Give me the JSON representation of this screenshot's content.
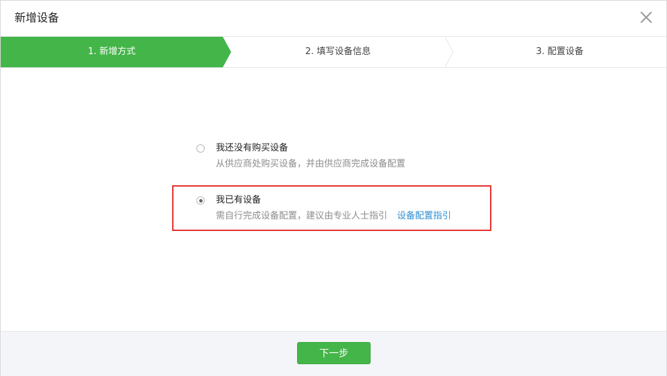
{
  "dialog": {
    "title": "新增设备",
    "close_icon": "close-icon"
  },
  "steps": [
    {
      "label": "1. 新增方式",
      "state": "active"
    },
    {
      "label": "2. 填写设备信息",
      "state": "inactive"
    },
    {
      "label": "3. 配置设备",
      "state": "inactive"
    }
  ],
  "options": [
    {
      "title": "我还没有购买设备",
      "description": "从供应商处购买设备，并由供应商完成设备配置",
      "selected": false
    },
    {
      "title": "我已有设备",
      "description": "需自行完成设备配置，建议由专业人士指引",
      "link": "设备配置指引",
      "selected": true
    }
  ],
  "footer": {
    "next_label": "下一步"
  },
  "colors": {
    "accent_green": "#44b549",
    "link_blue": "#2e8ed3",
    "highlight_red": "#e53333"
  }
}
